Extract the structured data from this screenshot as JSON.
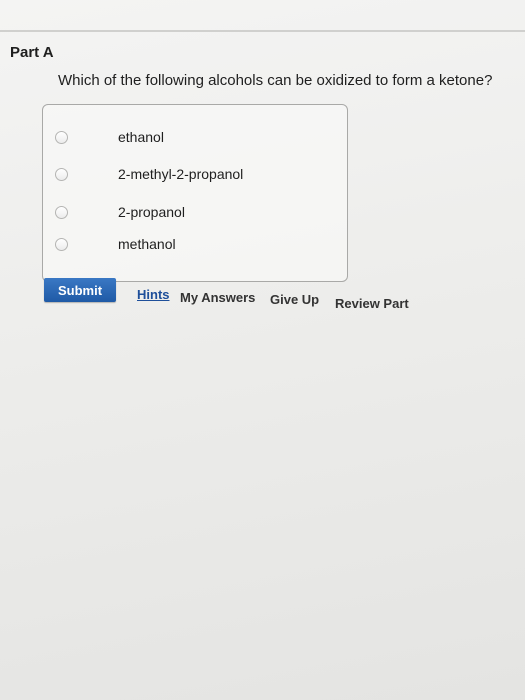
{
  "part": {
    "title": "Part A",
    "question": "Which of the following alcohols can be oxidized to form a ketone?"
  },
  "choices": [
    {
      "label": "ethanol",
      "selected": false
    },
    {
      "label": "2-methyl-2-propanol",
      "selected": false
    },
    {
      "label": "2-propanol",
      "selected": false
    },
    {
      "label": "methanol",
      "selected": false
    }
  ],
  "actions": {
    "submit_label": "Submit",
    "hints_label": "Hints",
    "my_answers_label": "My Answers",
    "give_up_label": "Give Up",
    "review_part_label": "Review Part"
  },
  "colors": {
    "submit_button": "#2a66b3",
    "hints_link": "#1e4f9a"
  }
}
